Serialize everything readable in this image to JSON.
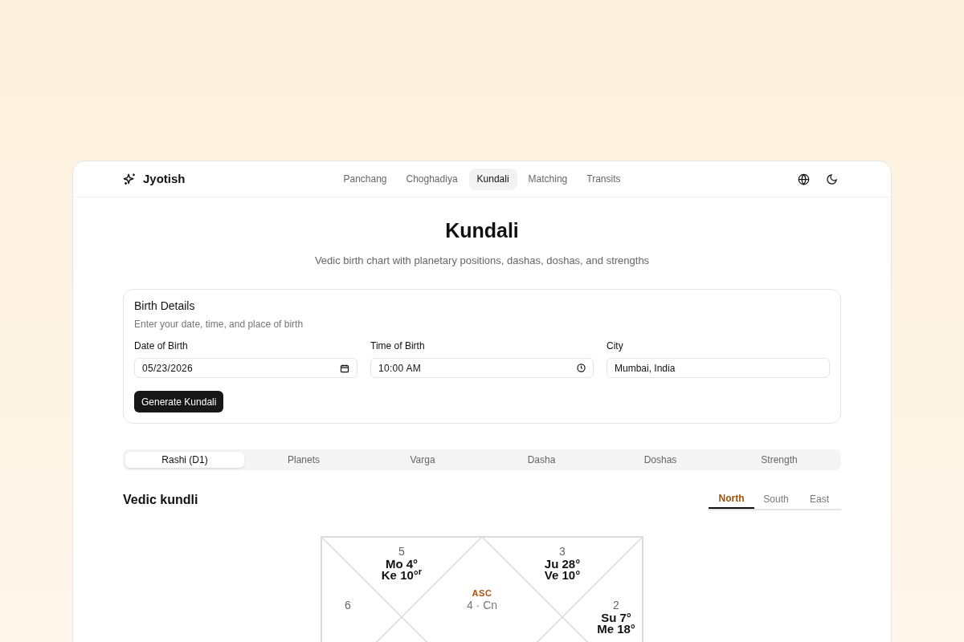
{
  "brand": {
    "name": "Jyotish"
  },
  "nav": [
    {
      "label": "Panchang",
      "selected": false
    },
    {
      "label": "Choghadiya",
      "selected": false
    },
    {
      "label": "Kundali",
      "selected": true
    },
    {
      "label": "Matching",
      "selected": false
    },
    {
      "label": "Transits",
      "selected": false
    }
  ],
  "page": {
    "title": "Kundali",
    "subtitle": "Vedic birth chart with planetary positions, dashas, doshas, and strengths"
  },
  "form": {
    "title": "Birth Details",
    "description": "Enter your date, time, and place of birth",
    "fields": [
      {
        "label": "Date of Birth",
        "value": "05/23/2026",
        "kind": "date"
      },
      {
        "label": "Time of Birth",
        "value": "10:00 AM",
        "kind": "time"
      },
      {
        "label": "City",
        "value": "Mumbai, India",
        "kind": "text"
      }
    ],
    "button": "Generate Kundali"
  },
  "tabs": [
    {
      "label": "Rashi (D1)",
      "selected": true
    },
    {
      "label": "Planets",
      "selected": false
    },
    {
      "label": "Varga",
      "selected": false
    },
    {
      "label": "Dasha",
      "selected": false
    },
    {
      "label": "Doshas",
      "selected": false
    },
    {
      "label": "Strength",
      "selected": false
    }
  ],
  "chart_section": {
    "title": "Vedic kundli",
    "styles": [
      {
        "label": "North",
        "selected": true
      },
      {
        "label": "South",
        "selected": false
      },
      {
        "label": "East",
        "selected": false
      }
    ]
  },
  "kundli": {
    "ascendant": {
      "label": "ASC",
      "text": "4 · Cn"
    },
    "houses": [
      {
        "number": "5",
        "planets": [
          "Mo 4°",
          "Ke 10°$^{r}$"
        ]
      },
      {
        "number": "3",
        "planets": [
          "Ju 28°",
          "Ve 10°"
        ]
      },
      {
        "number": "6"
      },
      {
        "number": "2",
        "planets": [
          "Su 7°",
          "Me 18°"
        ]
      }
    ]
  }
}
